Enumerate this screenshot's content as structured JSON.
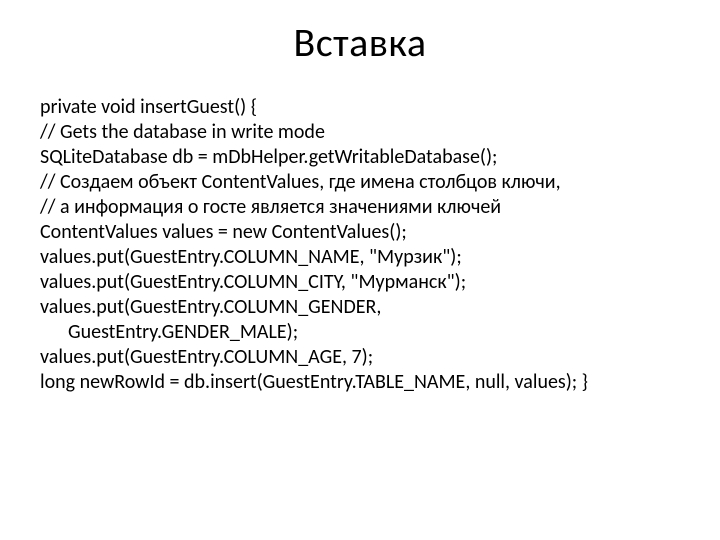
{
  "title": "Вставка",
  "code": {
    "l1": "private void insertGuest() {",
    "l2": " // Gets the database in write mode",
    "l3": " SQLiteDatabase db = mDbHelper.getWritableDatabase();",
    "l4": "// Создаем объект ContentValues, где имена столбцов ключи,",
    "l5": " // а информация о госте является значениями ключей",
    "l6": " ContentValues values = new ContentValues();",
    "l7": "values.put(GuestEntry.COLUMN_NAME, \"Мурзик\");",
    "l8": "values.put(GuestEntry.COLUMN_CITY, \"Мурманск\");",
    "l9": "values.put(GuestEntry.COLUMN_GENDER,",
    "l10": "GuestEntry.GENDER_MALE);",
    "l11": "values.put(GuestEntry.COLUMN_AGE, 7);",
    "l12": " long newRowId = db.insert(GuestEntry.TABLE_NAME, null, values); }"
  }
}
